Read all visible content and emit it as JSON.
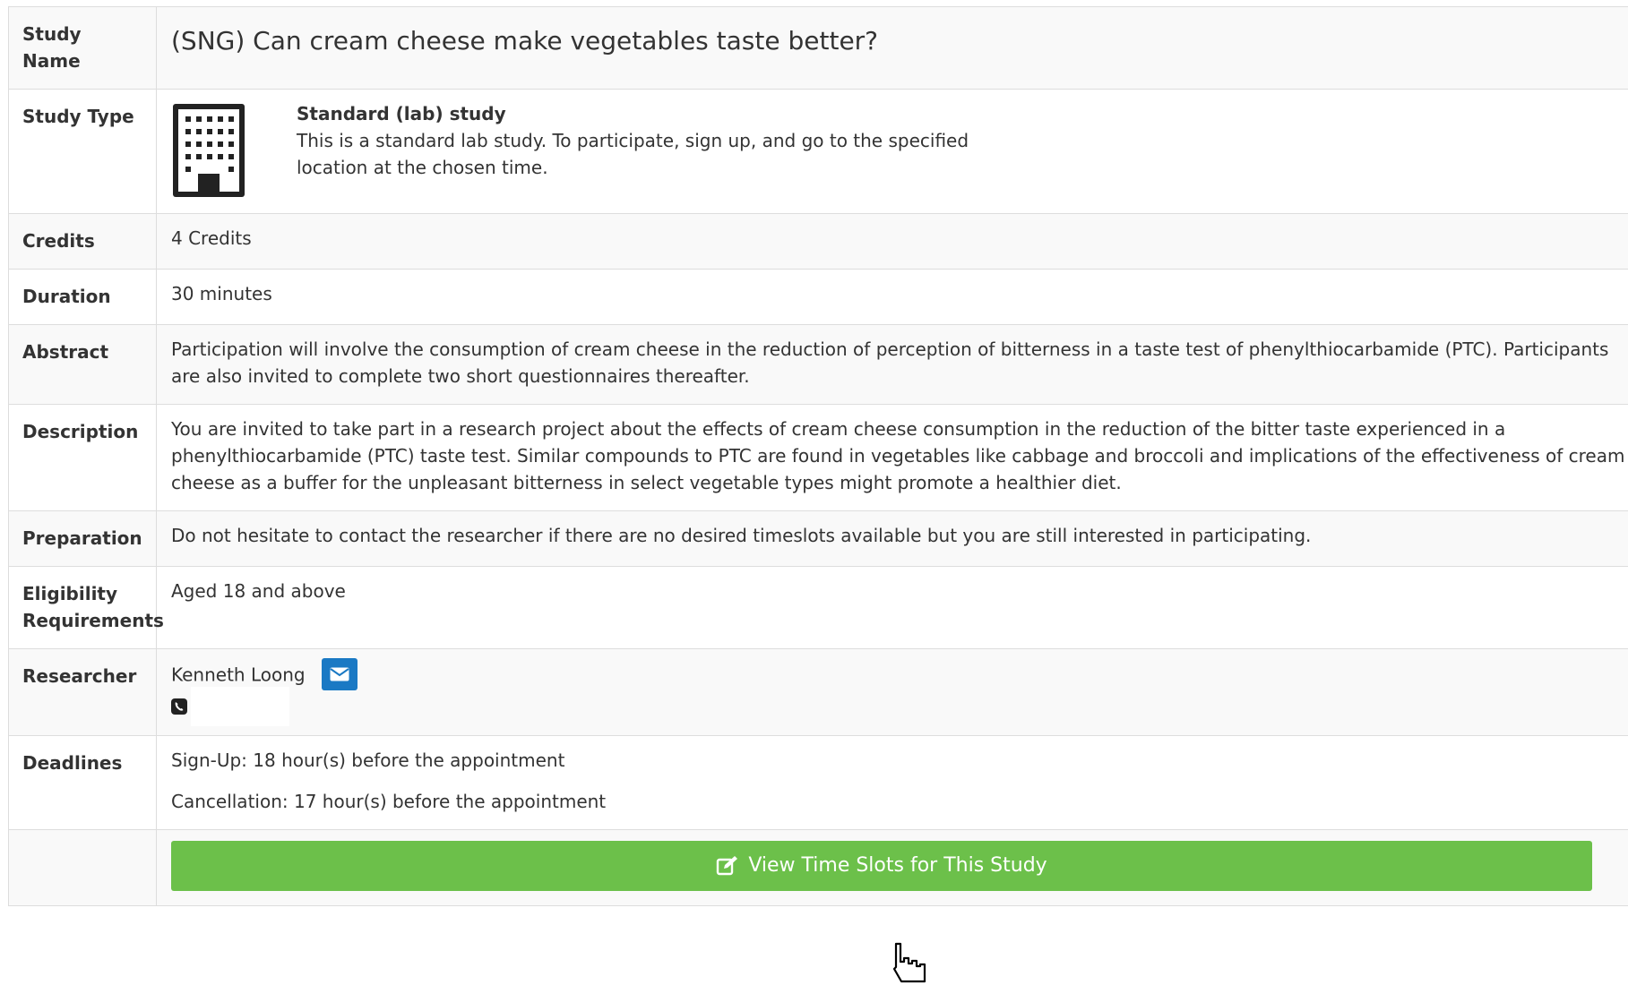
{
  "rows": {
    "study_name": {
      "label": "Study Name",
      "value": "(SNG) Can cream cheese make vegetables taste better?"
    },
    "study_type": {
      "label": "Study Type",
      "icon": "building-icon",
      "title": "Standard (lab) study",
      "description": "This is a standard lab study. To participate, sign up, and go to the specified location at the chosen time."
    },
    "credits": {
      "label": "Credits",
      "value": "4 Credits"
    },
    "duration": {
      "label": "Duration",
      "value": "30 minutes"
    },
    "abstract": {
      "label": "Abstract",
      "value": "Participation will involve the consumption of cream cheese in the reduction of perception of bitterness in a taste test of phenylthiocarbamide (PTC). Participants are also invited to complete two short questionnaires thereafter."
    },
    "description": {
      "label": "Description",
      "value": "You are invited to take part in a research project about the effects of cream cheese consumption in the reduction of the bitter taste experienced in a phenylthiocarbamide (PTC) taste test. Similar compounds to PTC are found in vegetables like cabbage and broccoli and implications of the effectiveness of cream cheese as a buffer for the unpleasant bitterness in select vegetable types might promote a healthier diet."
    },
    "preparation": {
      "label": "Preparation",
      "value": "Do not hesitate to contact the researcher if there are no desired timeslots available but you are still interested in participating."
    },
    "eligibility": {
      "label": "Eligibility Requirements",
      "value": "Aged 18 and above"
    },
    "researcher": {
      "label": "Researcher",
      "name": "Kenneth Loong",
      "email_icon": "envelope-icon",
      "phone_icon": "phone-icon"
    },
    "deadlines": {
      "label": "Deadlines",
      "signup": "Sign-Up:  18 hour(s) before the appointment",
      "cancellation": "Cancellation:  17 hour(s) before the appointment"
    }
  },
  "action_button": {
    "label": "View Time Slots for This Study",
    "icon": "edit-icon"
  },
  "colors": {
    "button_green": "#6cc04a",
    "email_blue": "#1a79c4",
    "stripe": "#f9f9f9",
    "border": "#dddddd"
  }
}
